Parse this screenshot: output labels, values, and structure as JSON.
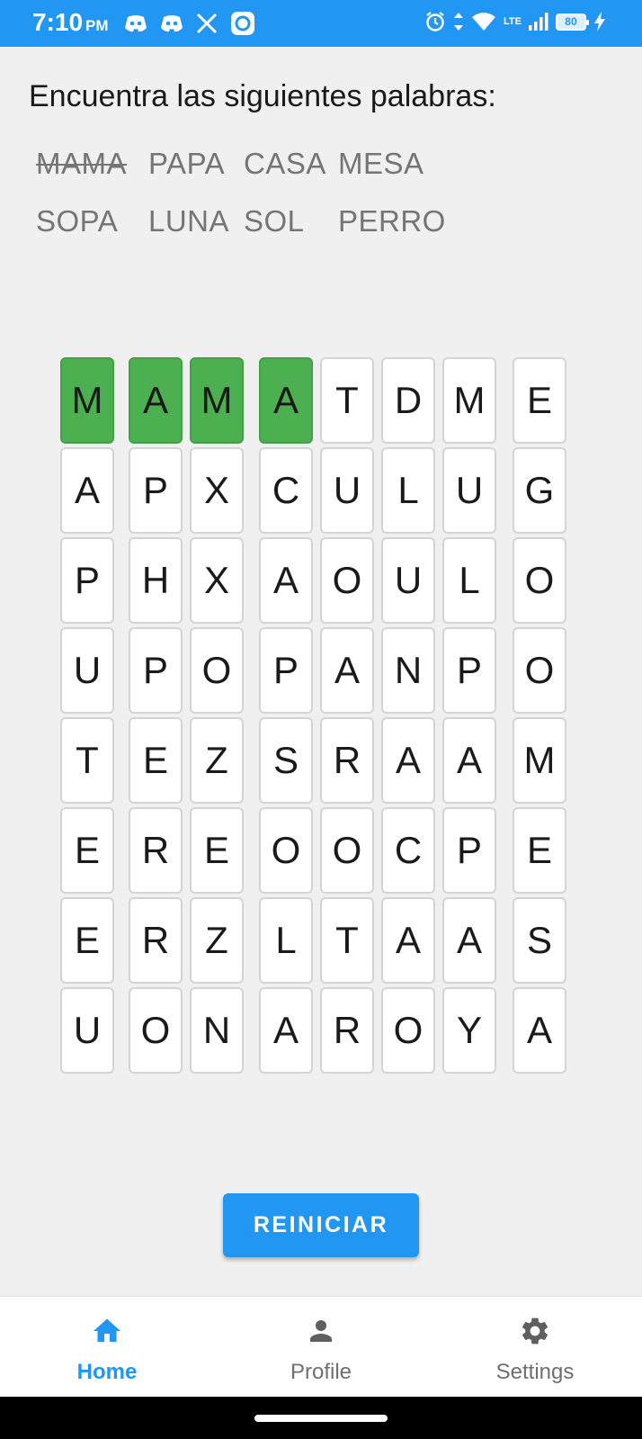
{
  "status_bar": {
    "time": "7:10",
    "time_suffix": "PM",
    "network": "LTE",
    "battery": "80",
    "left_icons": [
      "discord-icon",
      "discord-icon",
      "x-icon",
      "app-icon"
    ],
    "right_icons": [
      "alarm-icon",
      "data-arrows-icon",
      "wifi-icon",
      "signal-icon",
      "battery-icon",
      "charging-icon"
    ]
  },
  "instructions": "Encuentra las siguientes palabras:",
  "words": [
    {
      "text": "MAMA",
      "found": true
    },
    {
      "text": "PAPA",
      "found": false
    },
    {
      "text": "CASA",
      "found": false
    },
    {
      "text": "MESA",
      "found": false
    },
    {
      "text": "SOPA",
      "found": false
    },
    {
      "text": "LUNA",
      "found": false
    },
    {
      "text": "SOL",
      "found": false
    },
    {
      "text": "PERRO",
      "found": false
    }
  ],
  "grid": [
    [
      "M",
      "A",
      "M",
      "A",
      "T",
      "D",
      "M",
      "E"
    ],
    [
      "A",
      "P",
      "X",
      "C",
      "U",
      "L",
      "U",
      "G"
    ],
    [
      "P",
      "H",
      "X",
      "A",
      "O",
      "U",
      "L",
      "O"
    ],
    [
      "U",
      "P",
      "O",
      "P",
      "A",
      "N",
      "P",
      "O"
    ],
    [
      "T",
      "E",
      "Z",
      "S",
      "R",
      "A",
      "A",
      "M"
    ],
    [
      "E",
      "R",
      "E",
      "O",
      "O",
      "C",
      "P",
      "E"
    ],
    [
      "E",
      "R",
      "Z",
      "L",
      "T",
      "A",
      "A",
      "S"
    ],
    [
      "U",
      "O",
      "N",
      "A",
      "R",
      "O",
      "Y",
      "A"
    ]
  ],
  "highlighted": [
    [
      0,
      0
    ],
    [
      0,
      1
    ],
    [
      0,
      2
    ],
    [
      0,
      3
    ]
  ],
  "colors": {
    "accent": "#2196f3",
    "highlight": "#4caf50",
    "word_text": "#757575"
  },
  "reset_button": "REINICIAR",
  "bottom_nav": [
    {
      "label": "Home",
      "icon": "home-icon",
      "active": true
    },
    {
      "label": "Profile",
      "icon": "person-icon",
      "active": false
    },
    {
      "label": "Settings",
      "icon": "gear-icon",
      "active": false
    }
  ]
}
